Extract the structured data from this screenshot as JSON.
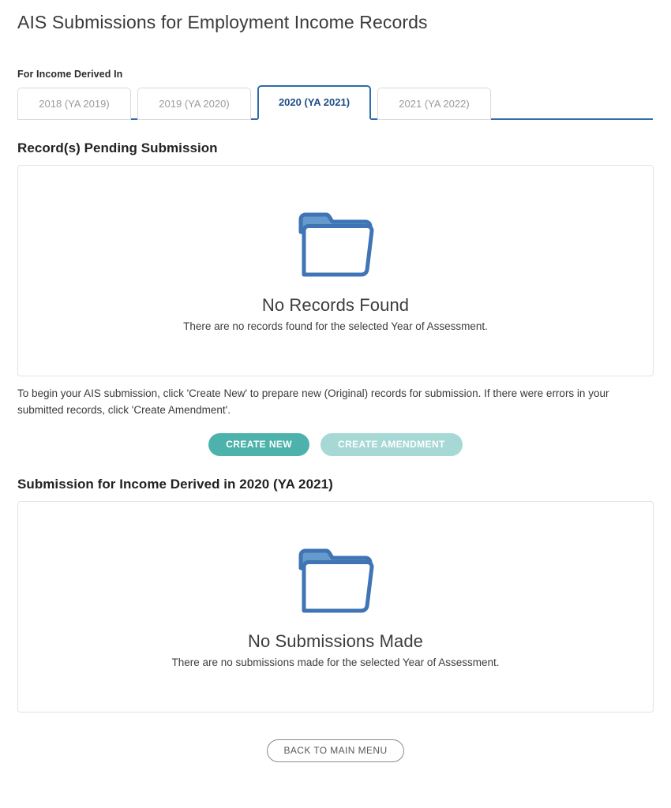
{
  "page": {
    "title": "AIS Submissions for Employment Income Records"
  },
  "tabs": {
    "label": "For Income Derived In",
    "items": [
      {
        "label": "2018 (YA 2019)",
        "active": false
      },
      {
        "label": "2019 (YA 2020)",
        "active": false
      },
      {
        "label": "2020 (YA 2021)",
        "active": true
      },
      {
        "label": "2021 (YA 2022)",
        "active": false
      }
    ]
  },
  "pending_section": {
    "heading": "Record(s) Pending Submission",
    "empty_state": {
      "icon": "open-folder-icon",
      "title": "No Records Found",
      "subtitle": "There are no records found for the selected Year of Assessment."
    },
    "helper_text": "To begin your AIS submission, click 'Create New' to prepare new (Original) records for submission. If there were errors in your submitted records, click 'Create Amendment'.",
    "buttons": {
      "create_new": "CREATE NEW",
      "create_amendment": "CREATE AMENDMENT"
    }
  },
  "submission_section": {
    "heading": "Submission for Income Derived in 2020 (YA 2021)",
    "empty_state": {
      "icon": "open-folder-icon",
      "title": "No Submissions Made",
      "subtitle": "There are no submissions made for the selected Year of Assessment."
    }
  },
  "footer": {
    "back_button": "BACK TO MAIN MENU"
  },
  "colors": {
    "tab_active_border": "#2e6cad",
    "tab_active_text": "#1f4e87",
    "primary_button": "#4eb2ac",
    "disabled_button": "#a6d8d5",
    "folder_icon": "#4a7fbf",
    "card_border": "#e3e3e3"
  }
}
